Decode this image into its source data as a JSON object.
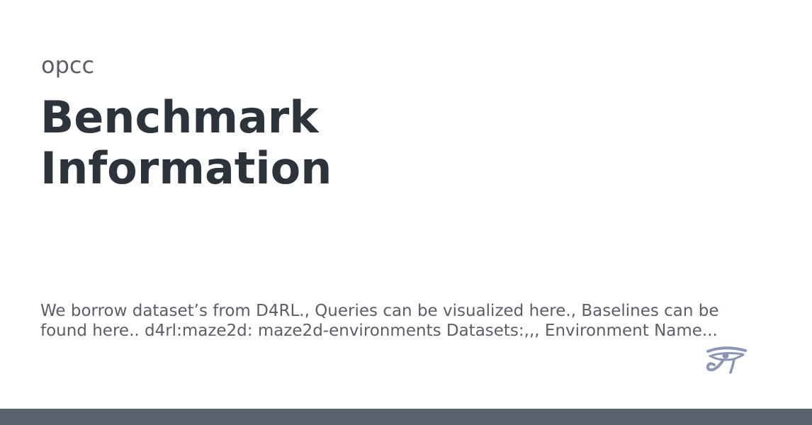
{
  "project": {
    "name": "opcc"
  },
  "page": {
    "title": "Benchmark Information",
    "description": "We borrow dataset’s from D4RL., Queries can be visualized here., Baselines can be found here.. d4rl:maze2d: maze2d-environments Datasets:,,, Environment Name..."
  },
  "logo": {
    "icon": "eye-of-horus-icon",
    "color": "#8a96b4"
  },
  "footer": {
    "color": "#5b616d"
  }
}
